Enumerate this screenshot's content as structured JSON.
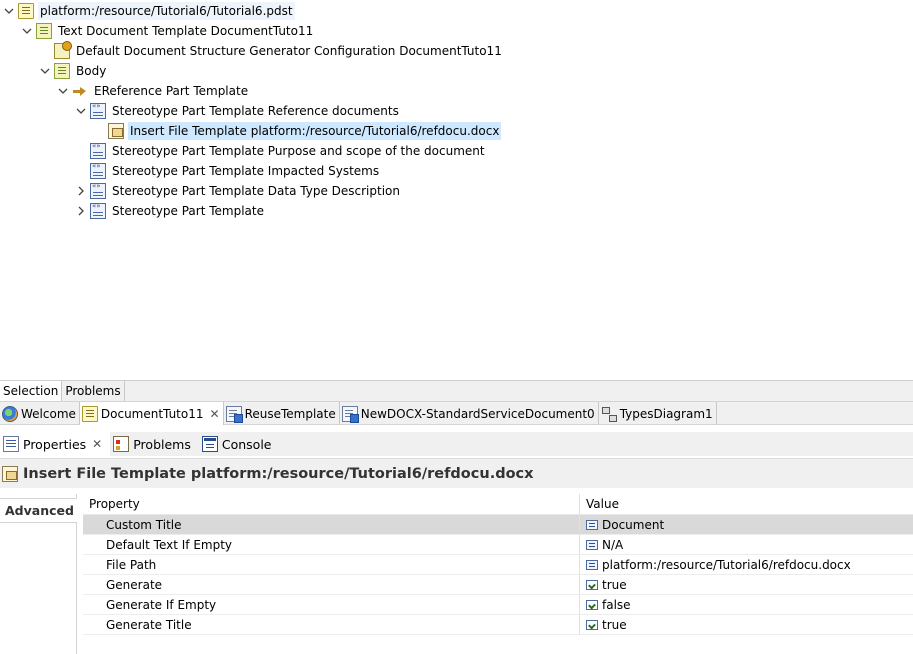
{
  "tree": {
    "root": "platform:/resource/Tutorial6/Tutorial6.pdst",
    "template": "Text Document Template DocumentTuto11",
    "config": "Default Document Structure Generator Configuration DocumentTuto11",
    "body": "Body",
    "ereference": "EReference Part Template",
    "stereo_ref": "Stereotype Part Template Reference documents",
    "insert_file": "Insert File Template platform:/resource/Tutorial6/refdocu.docx",
    "stereo_purpose": "Stereotype Part Template Purpose and scope of the document",
    "stereo_impacted": "Stereotype Part Template Impacted Systems",
    "stereo_datatype": "Stereotype Part Template Data Type Description",
    "stereo_plain": "Stereotype Part Template"
  },
  "selection_bar": {
    "selection": "Selection",
    "problems": "Problems"
  },
  "editor_tabs": {
    "welcome": "Welcome",
    "documenttuto11": "DocumentTuto11",
    "reuse": "ReuseTemplate",
    "newdocx": "NewDOCX-StandardServiceDocument0",
    "types": "TypesDiagram1"
  },
  "view_tabs": {
    "properties": "Properties",
    "problems": "Problems",
    "console": "Console"
  },
  "properties": {
    "title": "Insert File Template platform:/resource/Tutorial6/refdocu.docx",
    "advanced_tab": "Advanced",
    "col_property": "Property",
    "col_value": "Value",
    "rows": [
      {
        "name": "Custom Title",
        "value": "Document"
      },
      {
        "name": "Default Text If Empty",
        "value": "N/A"
      },
      {
        "name": "File Path",
        "value": "platform:/resource/Tutorial6/refdocu.docx"
      },
      {
        "name": "Generate",
        "value": "true"
      },
      {
        "name": "Generate If Empty",
        "value": "false"
      },
      {
        "name": "Generate Title",
        "value": "true"
      }
    ]
  }
}
